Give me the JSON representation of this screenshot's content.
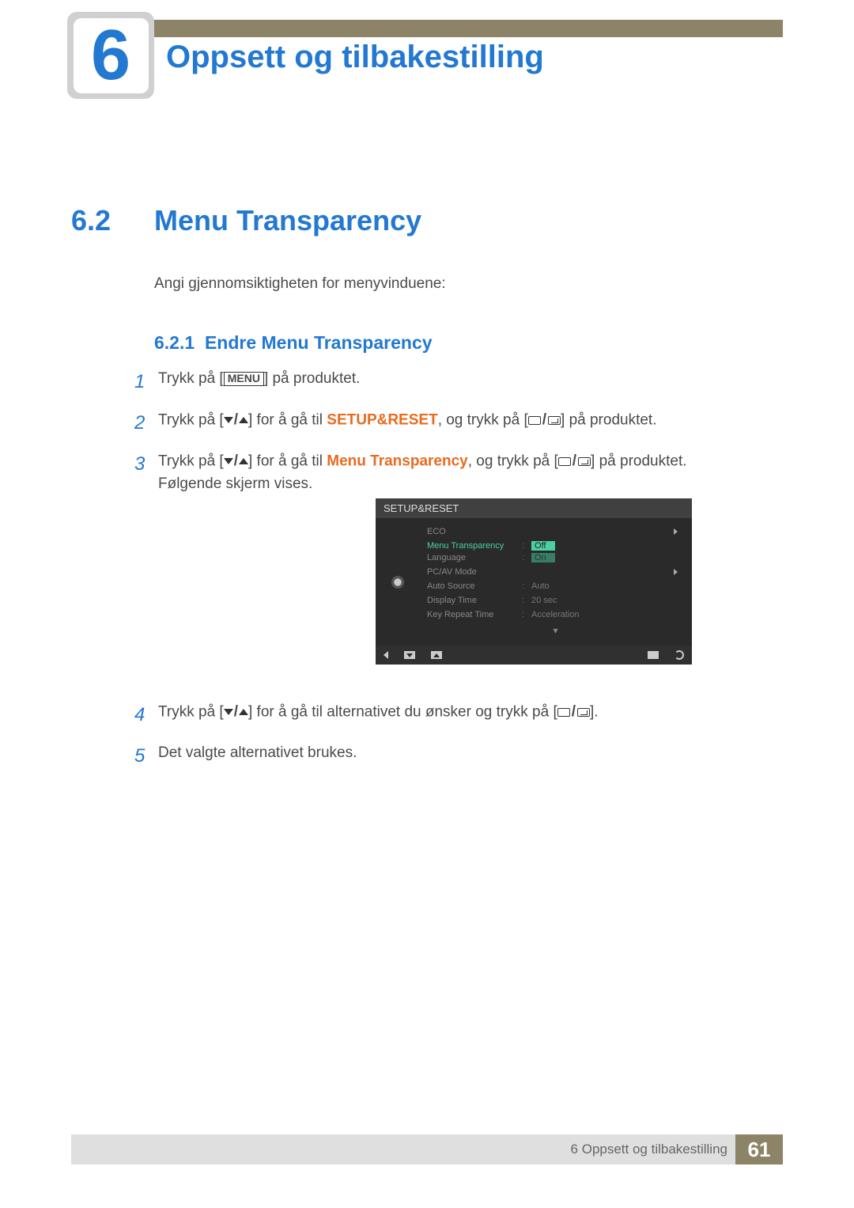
{
  "chapter": {
    "number": "6",
    "title": "Oppsett og tilbakestilling"
  },
  "section": {
    "number": "6.2",
    "title": "Menu Transparency",
    "intro": "Angi gjennomsiktigheten for menyvinduene:"
  },
  "subsection": {
    "number": "6.2.1",
    "title": "Endre Menu Transparency"
  },
  "steps": {
    "s1": {
      "num": "1",
      "a": "Trykk på [",
      "menu": "MENU",
      "b": "] på produktet."
    },
    "s2": {
      "num": "2",
      "a": "Trykk på [",
      "b": "] for å gå til ",
      "target": "SETUP&RESET",
      "c": ", og trykk på [",
      "d": "] på produktet."
    },
    "s3": {
      "num": "3",
      "a": "Trykk på [",
      "b": "] for å gå til ",
      "target": "Menu Transparency",
      "c": ", og trykk på [",
      "d": "] på produktet.",
      "e": "Følgende skjerm vises."
    },
    "s4": {
      "num": "4",
      "a": "Trykk på [",
      "b": "] for å gå til alternativet du ønsker og trykk på [",
      "c": "]."
    },
    "s5": {
      "num": "5",
      "a": "Det valgte alternativet brukes."
    }
  },
  "osd": {
    "header": "SETUP&RESET",
    "items": {
      "eco": {
        "label": "ECO",
        "value": ""
      },
      "transparency": {
        "label": "Menu Transparency",
        "off": "Off",
        "on": "On"
      },
      "language": {
        "label": "Language",
        "value": ""
      },
      "pcav": {
        "label": "PC/AV Mode",
        "value": ""
      },
      "autosource": {
        "label": "Auto Source",
        "value": "Auto"
      },
      "displaytime": {
        "label": "Display Time",
        "value": "20 sec"
      },
      "keyrepeat": {
        "label": "Key Repeat Time",
        "value": "Acceleration"
      }
    }
  },
  "footer": {
    "text": "6 Oppsett og tilbakestilling",
    "page": "61"
  }
}
